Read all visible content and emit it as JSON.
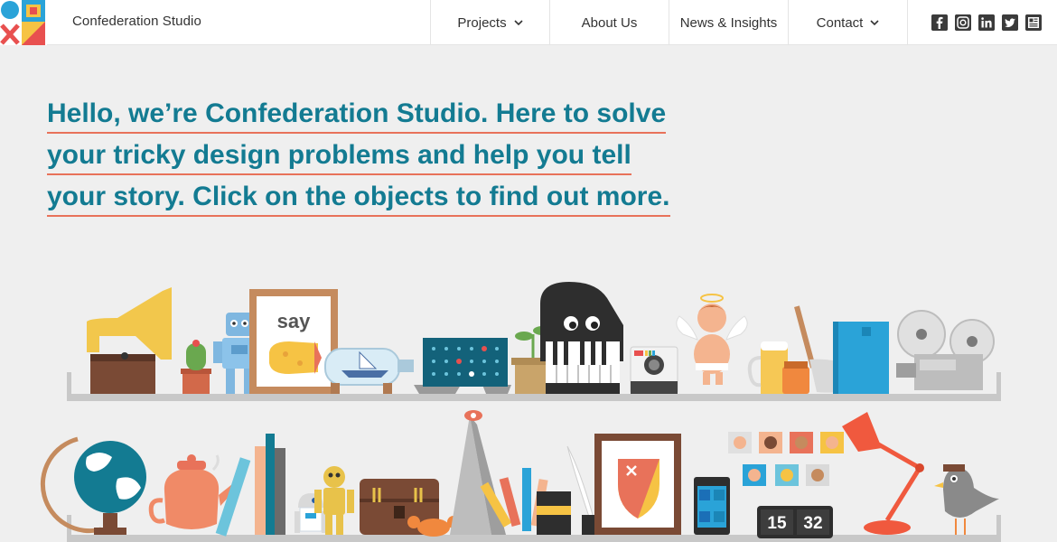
{
  "brand": {
    "name": "Confederation Studio"
  },
  "nav": {
    "projects": "Projects",
    "about": "About Us",
    "news": "News & Insights",
    "contact": "Contact"
  },
  "social": {
    "icons": [
      "facebook-icon",
      "instagram-icon",
      "linkedin-icon",
      "twitter-icon",
      "blog-icon"
    ]
  },
  "headline": {
    "line1": "Hello, we’re Confederation Studio. Here to solve",
    "line2": "your tricky design problems and help you tell",
    "line3": "your story. Click on the objects to find out more."
  },
  "objects": {
    "frame_word": "say",
    "clock_hour": "15",
    "clock_minute": "32"
  },
  "colors": {
    "accent_teal": "#137b92",
    "underline": "#e8725a",
    "background": "#efefef",
    "logo_blue": "#2aa3d8",
    "logo_yellow": "#f6c344",
    "logo_red": "#e8504f"
  }
}
